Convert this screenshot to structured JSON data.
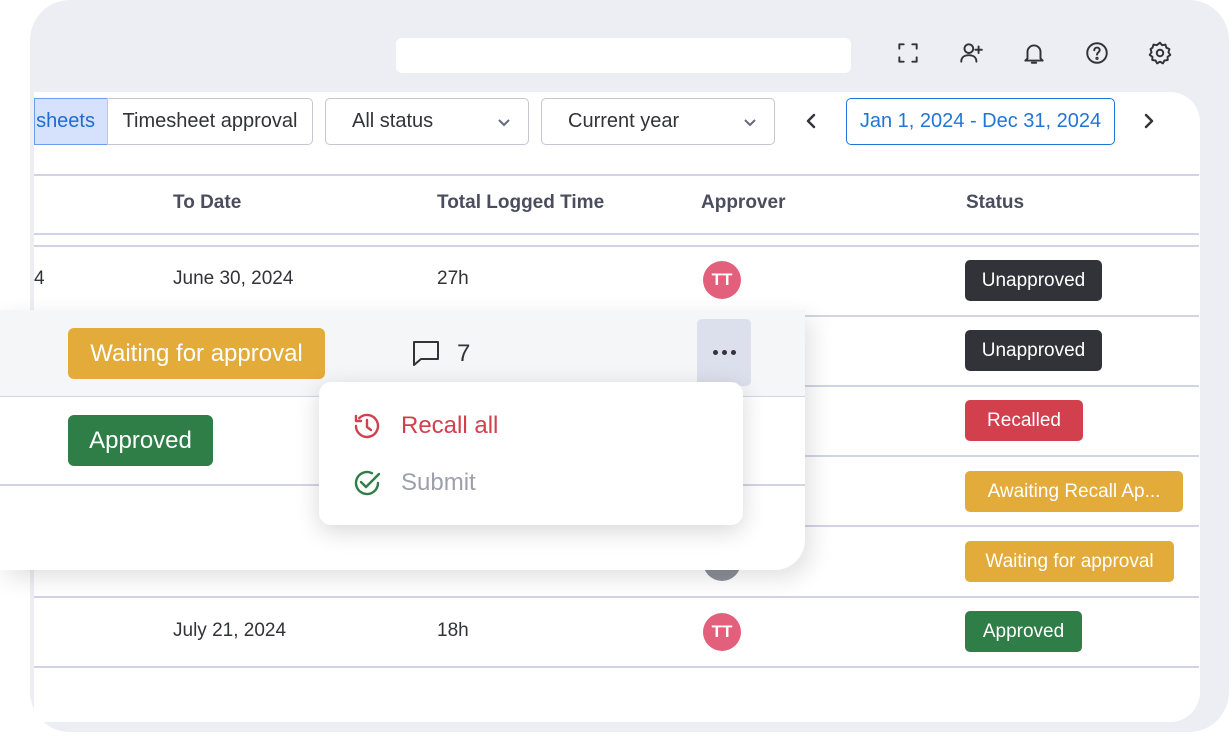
{
  "topbar": {
    "icons": [
      "fullscreen-icon",
      "invite-user-icon",
      "bell-icon",
      "help-icon",
      "settings-icon"
    ]
  },
  "toolbar": {
    "tab_active_label": "sheets",
    "tab_label": "Timesheet approval",
    "status_filter": "All status",
    "period_filter": "Current year",
    "date_range": "Jan 1, 2024 - Dec 31, 2024"
  },
  "table": {
    "headers": {
      "to_date": "To Date",
      "total_logged_time": "Total Logged Time",
      "approver": "Approver",
      "status": "Status"
    },
    "rows": [
      {
        "lead_fragment": "4",
        "to_date": "June 30, 2024",
        "total": "27h",
        "approver_initials": "TT",
        "status": "Unapproved"
      },
      {
        "status": "Unapproved"
      },
      {
        "status": "Recalled"
      },
      {
        "status": "Awaiting Recall Ap..."
      },
      {
        "status": "Waiting for approval"
      },
      {
        "to_date": "July 21, 2024",
        "total": "18h",
        "approver_initials": "TT",
        "status": "Approved"
      }
    ]
  },
  "overlay": {
    "row1_status": "Waiting for approval",
    "row1_comments": "7",
    "row2_status": "Approved"
  },
  "menu": {
    "recall_label": "Recall all",
    "submit_label": "Submit"
  },
  "colors": {
    "unapproved": "#323338",
    "recalled": "#d2404e",
    "waiting": "#e2ab3a",
    "approved": "#2f7d47",
    "primary": "#1f76d8",
    "avatar": "#e2607b"
  }
}
